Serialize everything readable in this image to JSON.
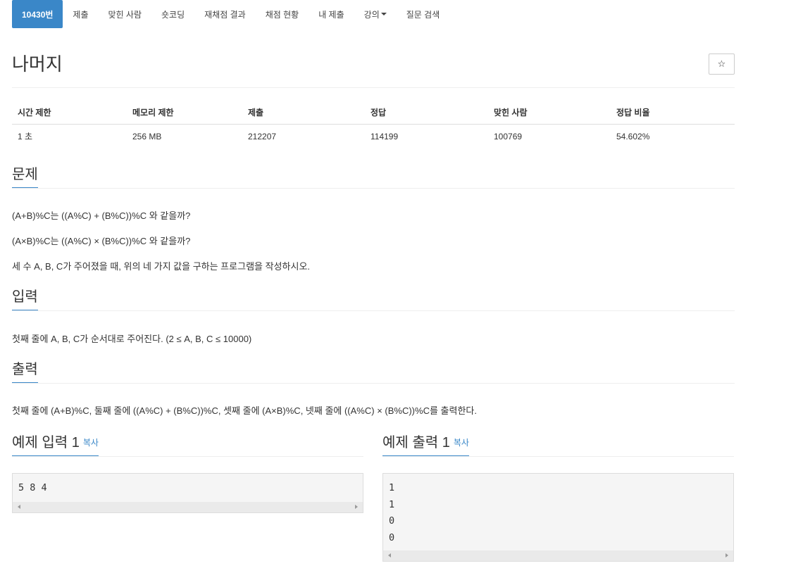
{
  "nav": {
    "tabs": [
      {
        "label": "10430번"
      },
      {
        "label": "제출"
      },
      {
        "label": "맞힌 사람"
      },
      {
        "label": "숏코딩"
      },
      {
        "label": "재채점 결과"
      },
      {
        "label": "채점 현황"
      },
      {
        "label": "내 제출"
      },
      {
        "label": "강의"
      },
      {
        "label": "질문 검색"
      }
    ]
  },
  "problem": {
    "title": "나머지",
    "star_icon": "☆"
  },
  "info_table": {
    "headers": [
      "시간 제한",
      "메모리 제한",
      "제출",
      "정답",
      "맞힌 사람",
      "정답 비율"
    ],
    "values": [
      "1 초",
      "256 MB",
      "212207",
      "114199",
      "100769",
      "54.602%"
    ]
  },
  "description": {
    "heading": "문제",
    "lines": [
      "(A+B)%C는 ((A%C) + (B%C))%C 와 같을까?",
      "(A×B)%C는 ((A%C) × (B%C))%C 와 같을까?",
      "세 수 A, B, C가 주어졌을 때, 위의 네 가지 값을 구하는 프로그램을 작성하시오."
    ]
  },
  "input": {
    "heading": "입력",
    "text": "첫째 줄에 A, B, C가 순서대로 주어진다. (2 ≤ A, B, C ≤ 10000)"
  },
  "output": {
    "heading": "출력",
    "text": "첫째 줄에 (A+B)%C, 둘째 줄에 ((A%C) + (B%C))%C, 셋째 줄에 (A×B)%C, 넷째 줄에 ((A%C) × (B%C))%C를 출력한다."
  },
  "sample_input": {
    "heading": "예제 입력 1",
    "copy_label": "복사",
    "lines": [
      "5 8 4"
    ]
  },
  "sample_output": {
    "heading": "예제 출력 1",
    "copy_label": "복사",
    "lines": [
      "1",
      "1",
      "0",
      "0"
    ]
  },
  "colors": {
    "accent": "#3a87c8",
    "text": "#333333",
    "code_bg": "#f5f5f5"
  }
}
